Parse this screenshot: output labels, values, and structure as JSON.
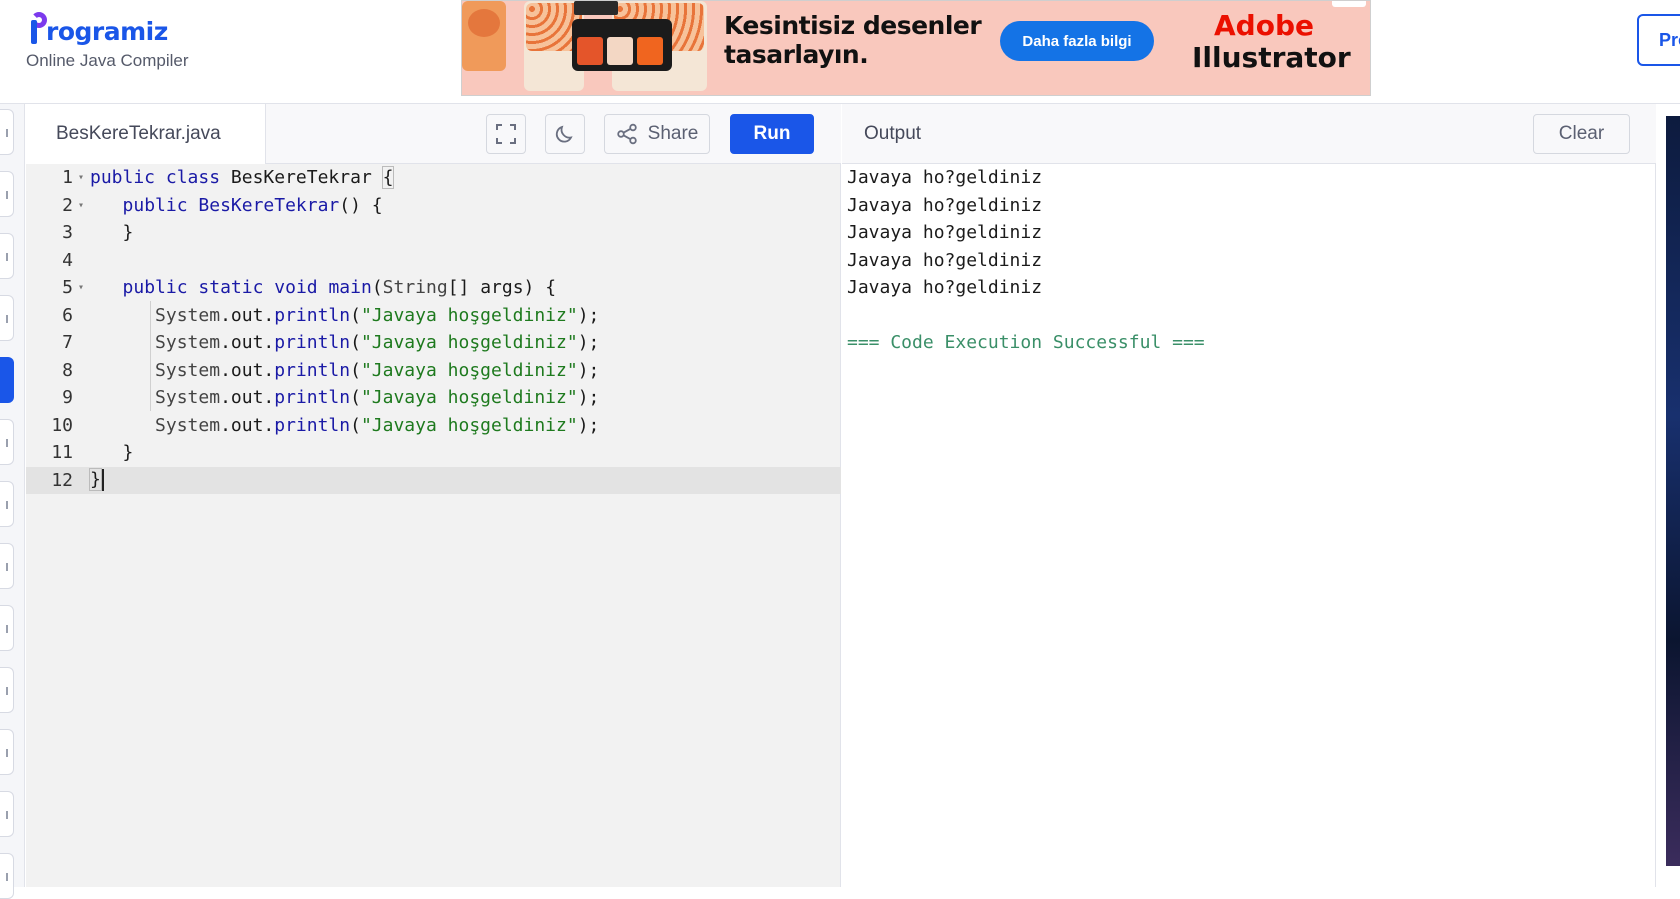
{
  "header": {
    "logo_text": "rogramiz",
    "subtitle": "Online Java Compiler",
    "right_button_label": "Pro"
  },
  "ad": {
    "headline_line1": "Kesintisiz desenler",
    "headline_line2": "tasarlayın.",
    "cta_label": "Daha fazla bilgi",
    "brand_line1": "Adobe",
    "brand_line2": "Illustrator"
  },
  "editor": {
    "file_name": "BesKereTekrar.java",
    "share_label": "Share",
    "run_label": "Run",
    "line_numbers": [
      "1",
      "2",
      "3",
      "4",
      "5",
      "6",
      "7",
      "8",
      "9",
      "10",
      "11",
      "12"
    ],
    "current_line": 12
  },
  "output": {
    "title": "Output",
    "clear_label": "Clear",
    "lines": [
      "Javaya ho?geldiniz",
      "Javaya ho?geldiniz",
      "Javaya ho?geldiniz",
      "Javaya ho?geldiniz",
      "Javaya ho?geldiniz"
    ],
    "status": "=== Code Execution Successful ==="
  },
  "colors": {
    "accent": "#1a56e8",
    "keyword": "#1a1aa6",
    "string": "#1e7a1e",
    "success": "#3a8f68"
  }
}
